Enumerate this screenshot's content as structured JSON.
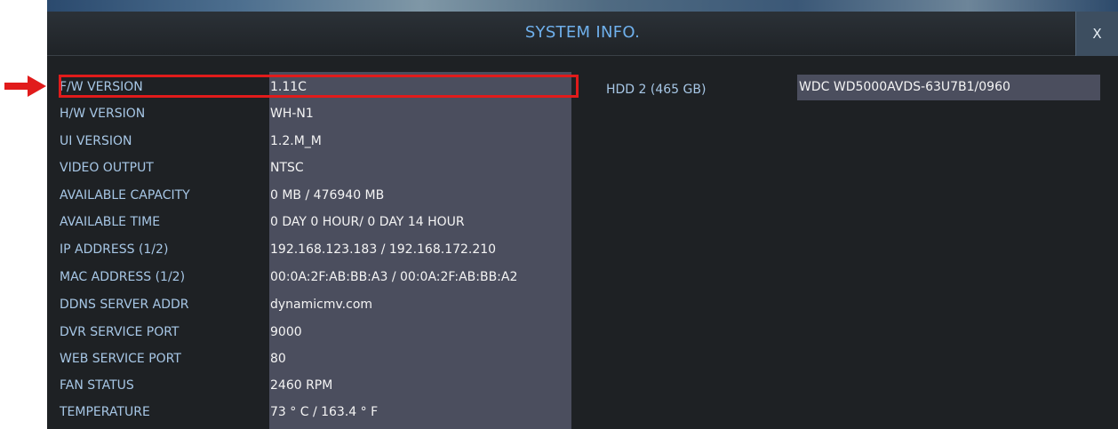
{
  "window": {
    "title": "SYSTEM INFO.",
    "close_label": "X"
  },
  "info_rows": [
    {
      "label": "F/W VERSION",
      "value": "1.11C"
    },
    {
      "label": "H/W VERSION",
      "value": "WH-N1"
    },
    {
      "label": "UI VERSION",
      "value": "1.2.M_M"
    },
    {
      "label": "VIDEO OUTPUT",
      "value": "NTSC"
    },
    {
      "label": "AVAILABLE CAPACITY",
      "value": "0 MB / 476940 MB"
    },
    {
      "label": "AVAILABLE TIME",
      "value": "0 DAY 0 HOUR/ 0 DAY 14 HOUR"
    },
    {
      "label": "IP ADDRESS (1/2)",
      "value": "192.168.123.183 / 192.168.172.210"
    },
    {
      "label": "MAC ADDRESS (1/2)",
      "value": "00:0A:2F:AB:BB:A3 / 00:0A:2F:AB:BB:A2"
    },
    {
      "label": "DDNS SERVER ADDR",
      "value": "dynamicmv.com"
    },
    {
      "label": "DVR SERVICE PORT",
      "value": "9000"
    },
    {
      "label": "WEB SERVICE PORT",
      "value": "80"
    },
    {
      "label": "FAN STATUS",
      "value": "2460 RPM"
    },
    {
      "label": "TEMPERATURE",
      "value": "73 ° C / 163.4 ° F"
    }
  ],
  "hdd": {
    "label": "HDD 2 (465 GB)",
    "value": "WDC WD5000AVDS-63U7B1/0960"
  },
  "annotation": {
    "color": "#e11b1b",
    "arrow_icon": "right-arrow-icon"
  }
}
